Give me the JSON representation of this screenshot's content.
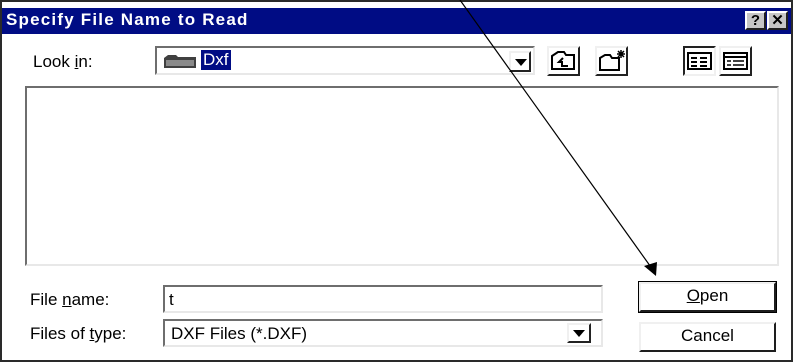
{
  "window": {
    "title": "Specify File Name to Read",
    "help_label": "?",
    "close_label": "✕"
  },
  "look_in": {
    "label_pre": "Look ",
    "label_key": "i",
    "label_post": "n:",
    "value": "Dxf"
  },
  "toolbar": {
    "up_folder_icon": "up-folder-icon",
    "new_folder_icon": "new-folder-icon",
    "list_view_icon": "list-view-icon",
    "details_view_icon": "details-view-icon"
  },
  "file_name": {
    "label_pre": "File ",
    "label_key": "n",
    "label_post": "ame:",
    "value": "t"
  },
  "file_type": {
    "label_pre": "Files of ",
    "label_key": "t",
    "label_post": "ype:",
    "value": "DXF Files (*.DXF)"
  },
  "buttons": {
    "open_key": "O",
    "open_post": "pen",
    "cancel": "Cancel"
  },
  "colors": {
    "titlebar": "#000c84",
    "face": "#c6c6c6"
  }
}
